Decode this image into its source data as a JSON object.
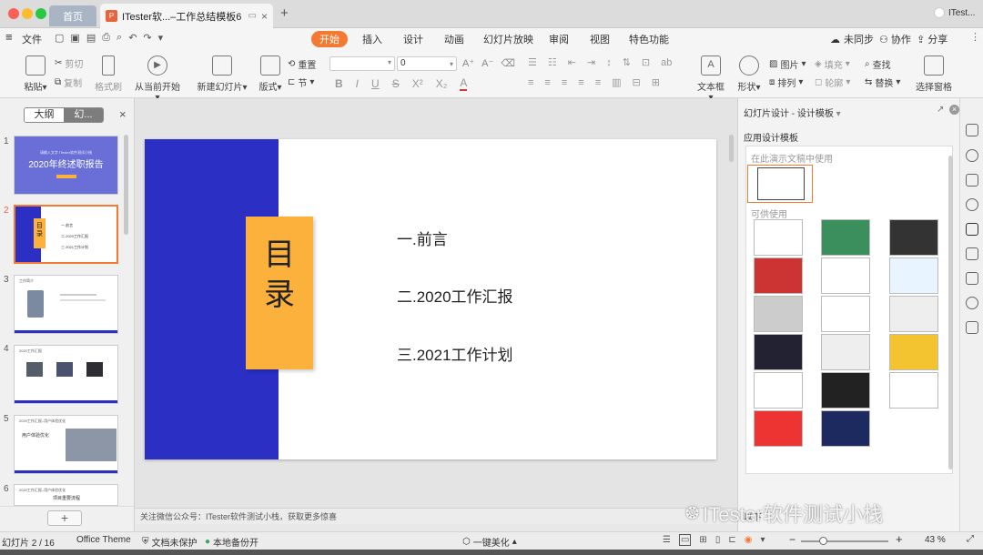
{
  "window": {
    "home_tab": "首页",
    "doc_tab": "ITester软...–工作总结模板6",
    "user_label": "ITest...",
    "new_tab": "+"
  },
  "menubar": {
    "file": "文件",
    "items": [
      "开始",
      "插入",
      "设计",
      "动画",
      "幻灯片放映",
      "审阅",
      "视图",
      "特色功能"
    ],
    "active": "开始",
    "right": [
      "未同步",
      "协作",
      "分享"
    ]
  },
  "ribbon": {
    "paste": "粘贴",
    "cut": "剪切",
    "copy": "复制",
    "format_painter": "格式刷",
    "from_current": "从当前开始",
    "new_slide": "新建幻灯片",
    "layout": "版式",
    "reset": "重置",
    "section": "节",
    "font_size_value": "0",
    "textbox": "文本框",
    "shape": "形状",
    "picture": "图片",
    "arrange": "排列",
    "fill": "填充",
    "outline": "轮廓",
    "find": "查找",
    "replace": "替换",
    "select_pane": "选择窗格"
  },
  "left_panel": {
    "tab_outline": "大纲",
    "tab_slides": "幻...",
    "close": "×",
    "slide_numbers": [
      "1",
      "2",
      "3",
      "4",
      "5",
      "6"
    ],
    "add_button": "+",
    "thumb1": {
      "subtitle": "请输入文字 ITester软件测试小栈",
      "title": "2020年终述职报告"
    },
    "thumb2": {
      "title": "目录",
      "items": [
        "一.前言",
        "二.2020工作汇报",
        "三.2021工作计划"
      ]
    },
    "thumb3": {
      "title": "工作简介"
    },
    "thumb4": {
      "title": "2020工作汇报"
    },
    "thumb5": {
      "title": "2020工作汇报–用户体验优化",
      "heading": "用户体验优化"
    },
    "thumb6": {
      "title": "2020工作汇报–用户体验优化",
      "heading": "项目重要流程"
    }
  },
  "slide": {
    "title": "目录",
    "items": [
      "一.前言",
      "二.2020工作汇报",
      "三.2021工作计划"
    ],
    "colors": {
      "blue": "#2b2fc4",
      "orange": "#fbb13c"
    }
  },
  "notes": "关注微信公众号：ITester软件测试小栈，获取更多惊喜",
  "right_panel": {
    "header": "幻灯片设计 - 设计模板",
    "apply_label": "应用设计模板",
    "in_doc_label": "在此演示文稿中使用",
    "available_label": "可供使用",
    "bottom_label": "以下",
    "watermark": "ITester软件测试小栈"
  },
  "statusbar": {
    "slide_info": "幻灯片 2 / 16",
    "theme": "Office Theme",
    "protect": "文档未保护",
    "backup": "本地备份开",
    "beautify": "一键美化",
    "zoom": "43 %"
  }
}
